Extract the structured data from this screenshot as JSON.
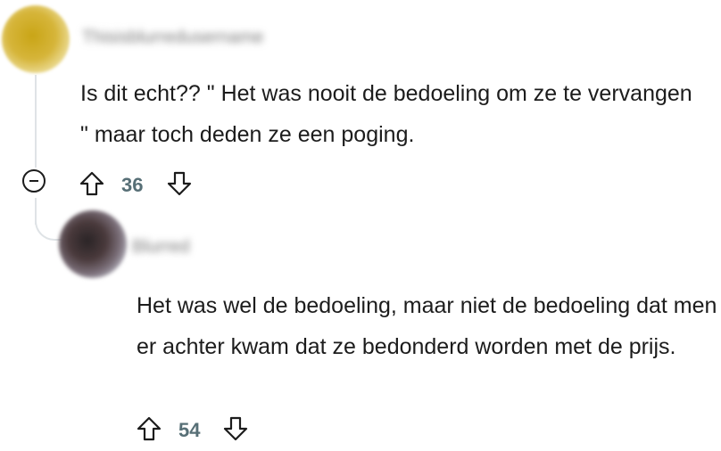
{
  "comments": [
    {
      "username": "Thisisblurredusername",
      "text": "Is dit echt?? \" Het was nooit de bedoeling om ze te vervangen \" maar toch deden ze een poging.",
      "votes": "36"
    },
    {
      "username": "Blurred",
      "text": "Het was wel de bedoeling, maar niet de bedoeling dat men er achter kwam dat ze bedonderd worden met de prijs.",
      "votes": "54"
    }
  ],
  "icons": {
    "collapse": "collapse-minus-icon",
    "upvote": "upvote-arrow-icon",
    "downvote": "downvote-arrow-icon"
  },
  "colors": {
    "text": "#1c1c1c",
    "vote_count": "#576f76",
    "thread_line": "#dfe3e6"
  }
}
